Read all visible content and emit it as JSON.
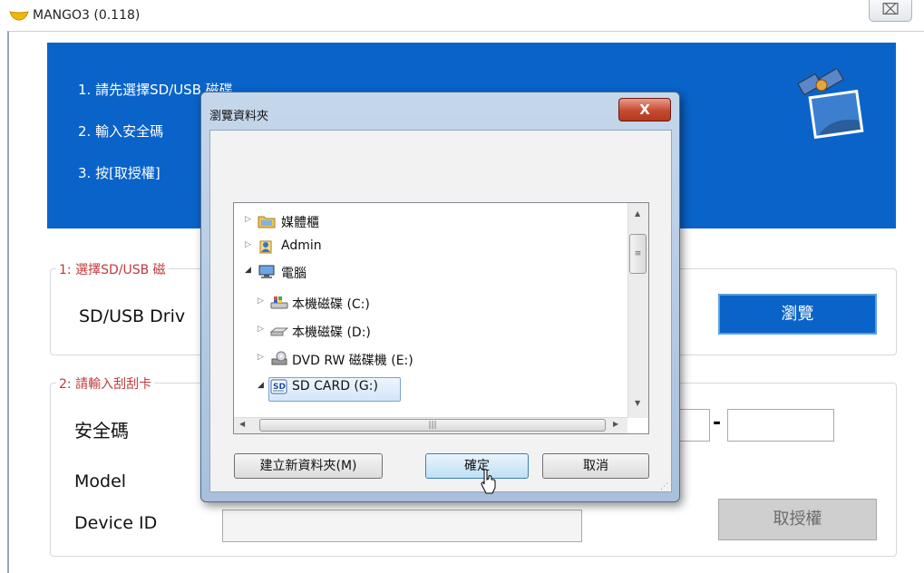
{
  "window": {
    "title": "MANGO3 (0.118)",
    "close_symbol": "⌧"
  },
  "banner": {
    "steps": [
      "1. 請先選擇SD/USB 磁碟",
      "2. 輸入安全碼",
      "3. 按[取授權]"
    ]
  },
  "section1": {
    "legend": "1: 選擇SD/USB 磁",
    "drive_label": "SD/USB Driv",
    "browse_label": "瀏覽"
  },
  "section2": {
    "legend": "2: 請輸入刮刮卡",
    "security_code_label": "安全碼",
    "dash": "-",
    "model_label": "Model",
    "device_id_label": "Device ID",
    "deauth_label": "取授權"
  },
  "dialog": {
    "title": "瀏覽資料夾",
    "close_label": "X",
    "tree": [
      {
        "label": "媒體櫃",
        "icon": "library-icon",
        "expanded": false
      },
      {
        "label": "Admin",
        "icon": "user-folder-icon",
        "expanded": false
      },
      {
        "label": "電腦",
        "icon": "computer-icon",
        "expanded": true
      },
      {
        "label": "本機磁碟 (C:)",
        "icon": "windows-drive-icon",
        "expanded": false
      },
      {
        "label": "本機磁碟 (D:)",
        "icon": "hard-drive-icon",
        "expanded": false
      },
      {
        "label": "DVD RW 磁碟機 (E:)",
        "icon": "dvd-drive-icon",
        "expanded": false
      },
      {
        "label": "SD CARD (G:)",
        "icon": "sd-card-icon",
        "expanded": true,
        "selected": true
      }
    ],
    "new_folder_label": "建立新資料夾(M)",
    "ok_label": "確定",
    "cancel_label": "取消"
  },
  "colors": {
    "banner_blue": "#0a63c9",
    "legend_red": "#c0393b",
    "dialog_frame": "#a8c0dc"
  }
}
